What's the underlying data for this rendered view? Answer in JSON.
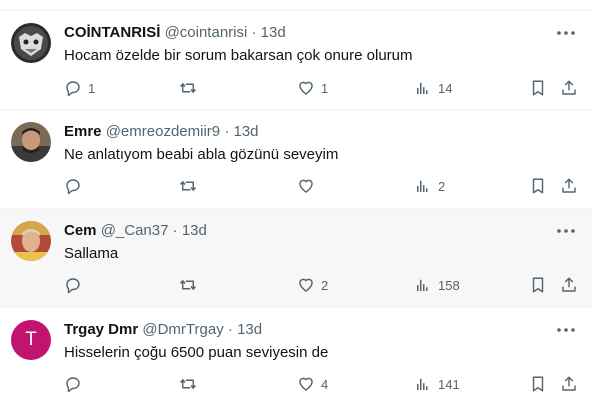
{
  "tweets": [
    {
      "name": "COİNTANRISİ",
      "handle": "@cointanrisi",
      "dot": "·",
      "time": "13d",
      "text": "Hocam özelde bir sorum bakarsan çok onure olurum",
      "replies": "1",
      "retweets": "",
      "likes": "1",
      "views": "14",
      "highlighted": false,
      "avatar": "dark-illustration-avatar"
    },
    {
      "name": "Emre",
      "handle": "@emreozdemiir9",
      "dot": "·",
      "time": "13d",
      "text": "Ne anlatıyom beabi abla gözünü seveyim",
      "replies": "",
      "retweets": "",
      "likes": "",
      "views": "2",
      "highlighted": false,
      "avatar": "photo-avatar"
    },
    {
      "name": "Cem",
      "handle": "@_Can37",
      "dot": "·",
      "time": "13d",
      "text": "Sallama",
      "replies": "",
      "retweets": "",
      "likes": "2",
      "views": "158",
      "highlighted": true,
      "avatar": "photo-avatar"
    },
    {
      "name": "Trgay Dmr",
      "handle": "@DmrTrgay",
      "dot": "·",
      "time": "13d",
      "text": "Hisselerin çoğu 6500 puan seviyesin de",
      "replies": "",
      "retweets": "",
      "likes": "4",
      "views": "141",
      "highlighted": false,
      "avatar": "T"
    }
  ],
  "colors": {
    "text": "#0f1419",
    "secondary": "#536471",
    "divider": "#eff3f4",
    "highlight_bg": "#f7f7f7",
    "avatar_t_bg": "#c0146f"
  }
}
